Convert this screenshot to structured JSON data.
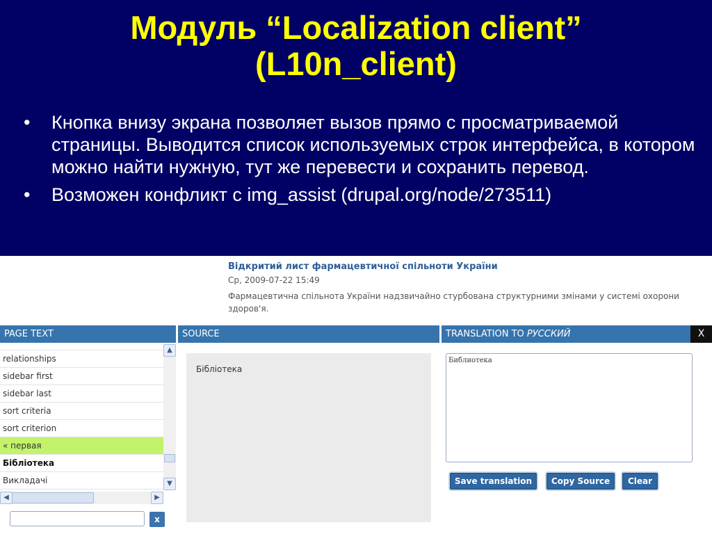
{
  "slide": {
    "title_line1": "Модуль “Localization client”",
    "title_line2": "(L10n_client)",
    "bullets": [
      "Кнопка внизу экрана позволяет вызов прямо с просматриваемой страницы. Выводится список используемых строк интерфейса, в котором можно найти нужную, тут же перевести и сохранить перевод.",
      "Возможен конфликт с img_assist (drupal.org/node/273511)"
    ],
    "bullet_symbol": "•"
  },
  "article": {
    "title": "Відкритий лист фармацевтичної спільноти України",
    "date": "Ср, 2009-07-22 15:49",
    "body": "Фармацевтична спільнота України надзвичайно стурбована структурними змінами у системі охорони здоров'я."
  },
  "l10n": {
    "page_text_header": "PAGE TEXT",
    "source_header": "SOURCE",
    "translation_header_prefix": "TRANSLATION TO ",
    "translation_language": "РУССКИЙ",
    "close_label": "X",
    "strings": [
      {
        "text": "relationships",
        "state": "normal"
      },
      {
        "text": "sidebar first",
        "state": "normal"
      },
      {
        "text": "sidebar last",
        "state": "normal"
      },
      {
        "text": "sort criteria",
        "state": "normal"
      },
      {
        "text": "sort criterion",
        "state": "normal"
      },
      {
        "text": "« первая",
        "state": "highlighted"
      },
      {
        "text": "Бібліотека",
        "state": "selected"
      },
      {
        "text": "Викладачі",
        "state": "normal"
      }
    ],
    "filter_value": "",
    "filter_clear_label": "x",
    "source_text": "Бібліотека",
    "translation_value": "Библиотека",
    "buttons": {
      "save": "Save translation",
      "copy": "Copy Source",
      "clear": "Clear"
    },
    "scroll_arrows": {
      "up": "▲",
      "down": "▼",
      "left": "◀",
      "right": "▶"
    }
  },
  "colors": {
    "slide_background": "#010065",
    "title": "#ffff00",
    "panel_header": "#3674ad",
    "highlight_row": "#c2f36a"
  }
}
